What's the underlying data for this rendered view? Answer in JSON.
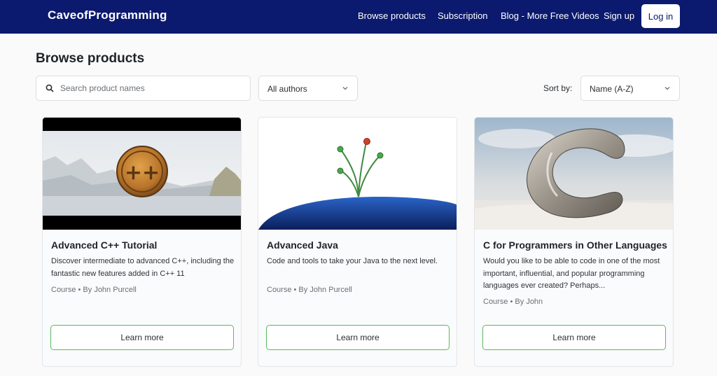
{
  "header": {
    "logo": "CaveofProgramming",
    "nav": [
      "Browse products",
      "Subscription",
      "Blog - More Free Videos",
      "Sign up"
    ],
    "login_label": "Log in"
  },
  "page": {
    "title": "Browse products"
  },
  "filters": {
    "search_placeholder": "Search product names",
    "authors_selected": "All authors",
    "sort_label": "Sort by:",
    "sort_selected": "Name (A-Z)"
  },
  "products": [
    {
      "title": "Advanced C++ Tutorial",
      "description": "Discover intermediate to advanced C++, including the fantastic new features added in C++ 11",
      "meta": "Course • By John Purcell",
      "button": "Learn more"
    },
    {
      "title": "Advanced Java",
      "description": "Code and tools to take your Java to the next level.",
      "meta": "Course • By John Purcell",
      "button": "Learn more"
    },
    {
      "title": "C for Programmers in Other Languages",
      "description": "Would you like to be able to code in one of the most important, influential, and popular programming languages ever created? Perhaps...",
      "meta": "Course • By John",
      "button": "Learn more"
    }
  ],
  "colors": {
    "header_bg": "#0b1a6e",
    "button_border": "#5cb85c"
  }
}
